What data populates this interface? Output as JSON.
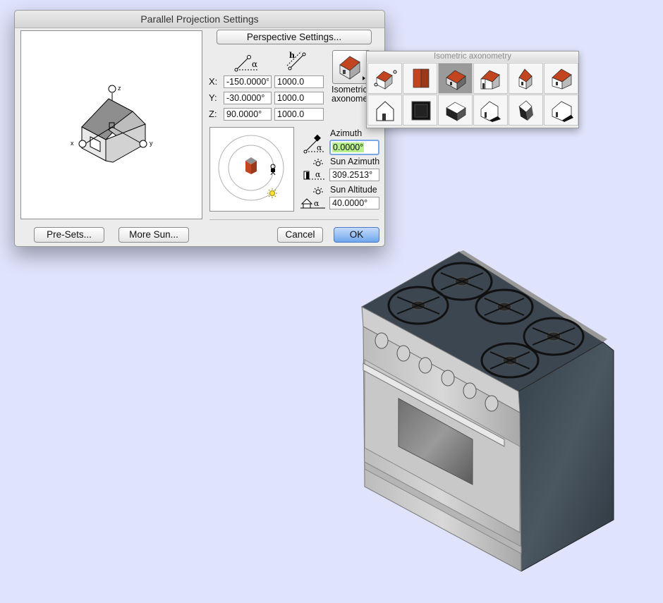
{
  "dialog": {
    "title": "Parallel Projection Settings",
    "perspective_button": "Perspective Settings...",
    "axis_labels": {
      "x": "X:",
      "y": "Y:",
      "z": "Z:"
    },
    "angle_header_icon": "angle-alpha-icon",
    "length_header_icon": "height-h-icon",
    "values": {
      "x_angle": "-150.0000°",
      "x_length": "1000.0",
      "y_angle": "-30.0000°",
      "y_length": "1000.0",
      "z_angle": "90.0000°",
      "z_length": "1000.0"
    },
    "preview_axis_labels": {
      "z": "z",
      "x": "x",
      "y": "y"
    },
    "preset_caption_line1": "Isometric",
    "preset_caption_line2": "axonome",
    "azimuth": {
      "label": "Azimuth",
      "value": "0.0000°"
    },
    "sun_azimuth": {
      "label": "Sun Azimuth",
      "value": "309.2513°"
    },
    "sun_altitude": {
      "label": "Sun Altitude",
      "value": "40.0000°"
    },
    "buttons": {
      "presets": "Pre-Sets...",
      "more_sun": "More Sun...",
      "cancel": "Cancel",
      "ok": "OK"
    }
  },
  "popup": {
    "title": "Isometric axonometry",
    "row1": [
      "custom-axonometry-icon",
      "front-elevation-icon",
      "isometric-house-icon",
      "monometric-house-icon",
      "dimetric-house-icon",
      "trimetric-house-icon"
    ],
    "row2": [
      "plan-house-icon",
      "top-plan-icon",
      "bottom-isometric-icon",
      "bottom-monometric-icon",
      "bottom-dimetric-icon",
      "bottom-trimetric-icon"
    ],
    "selected_index": 2
  },
  "colors": {
    "background": "#dfe3fb",
    "roof_red": "#c2451f",
    "selection_highlight": "#b8f08c",
    "stove_top": "#3b4650"
  }
}
